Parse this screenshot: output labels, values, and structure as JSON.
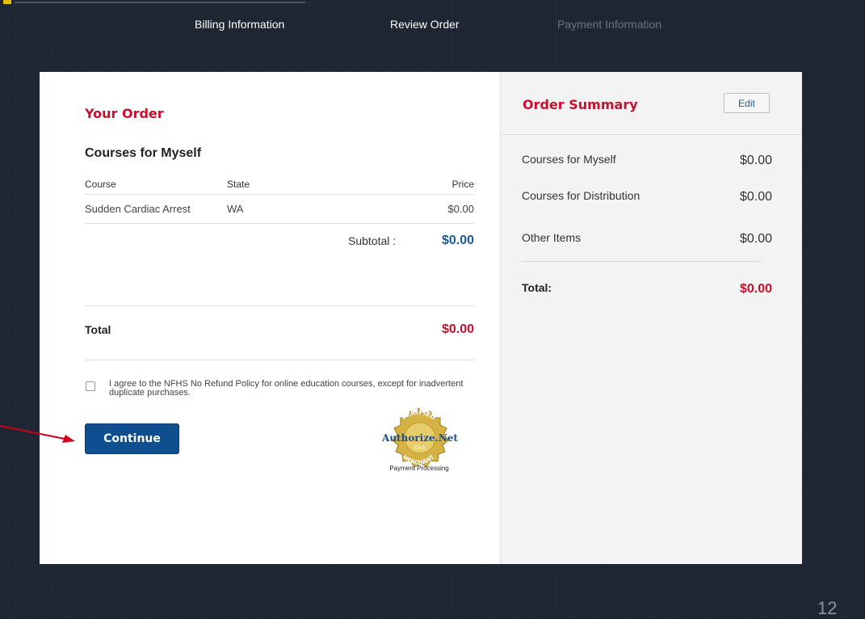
{
  "steps": {
    "billing": "Billing Information",
    "review": "Review Order",
    "payment": "Payment Information"
  },
  "order": {
    "title": "Your Order",
    "section_title": "Courses for Myself",
    "columns": {
      "course": "Course",
      "state": "State",
      "price": "Price"
    },
    "rows": [
      {
        "course": "Sudden Cardiac Arrest",
        "state": "WA",
        "price": "$0.00"
      }
    ],
    "subtotal_label": "Subtotal :",
    "subtotal_value": "$0.00",
    "total_label": "Total",
    "total_value": "$0.00",
    "agree_text": "I agree to the NFHS No Refund Policy for online education courses, except for inadvertent duplicate purchases.",
    "agree_checked": false,
    "continue_label": "Continue"
  },
  "seal": {
    "name": "Authorize.Net",
    "top_text": "VERIFIED",
    "bottom_text": "MERCHANT",
    "click_text": "Click",
    "caption": "Payment Processing"
  },
  "summary": {
    "title": "Order Summary",
    "edit_label": "Edit",
    "rows": [
      {
        "label": "Courses for Myself",
        "value": "$0.00"
      },
      {
        "label": "Courses for Distribution",
        "value": "$0.00"
      },
      {
        "label": "Other Items",
        "value": "$0.00"
      }
    ],
    "total_label": "Total:",
    "total_value": "$0.00"
  },
  "slide_number": "12",
  "colors": {
    "accent_red": "#c8102e",
    "accent_blue": "#1a5a9a",
    "button_blue": "#0f4f8f",
    "background": "#1b2430"
  }
}
